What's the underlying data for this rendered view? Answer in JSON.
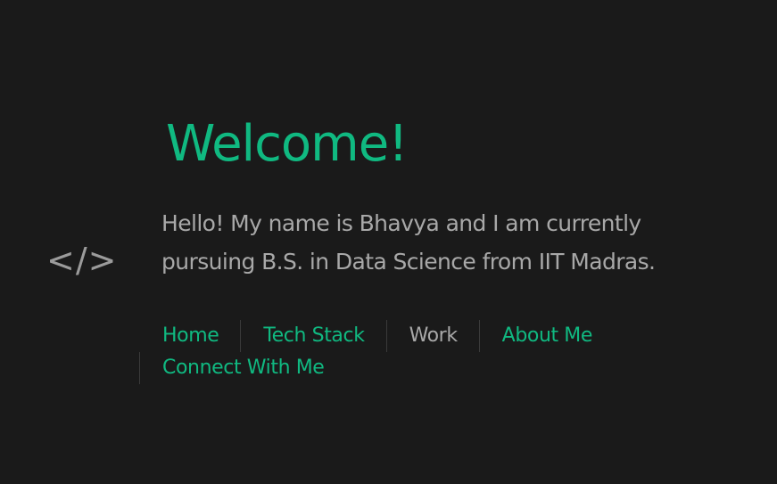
{
  "logo": {
    "text": "</>"
  },
  "hero": {
    "title": "Welcome!",
    "intro": "Hello! My name is Bhavya and I am currently pursuing B.S. in Data Science from IIT Madras."
  },
  "nav": {
    "items": [
      {
        "label": "Home",
        "current": false
      },
      {
        "label": "Tech Stack",
        "current": false
      },
      {
        "label": "Work",
        "current": true
      },
      {
        "label": "About Me",
        "current": false
      },
      {
        "label": "Connect With Me",
        "current": false
      }
    ]
  },
  "colors": {
    "background": "#1a1a1a",
    "accent": "#10b981",
    "text_muted": "#a8a8a8",
    "divider": "#3a3a3a"
  }
}
